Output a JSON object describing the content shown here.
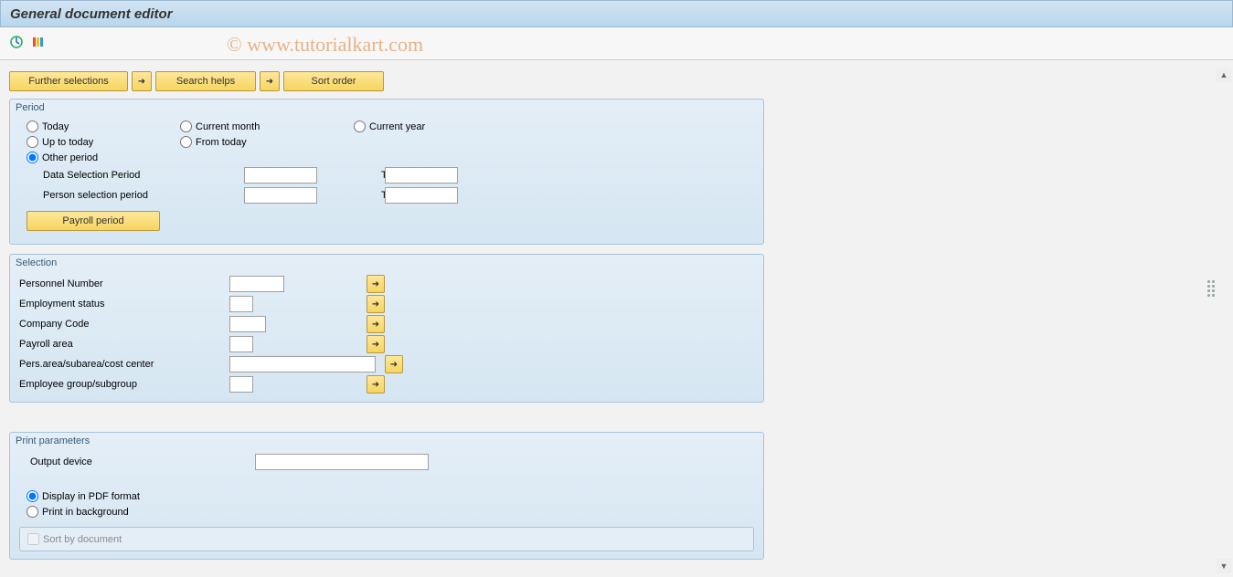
{
  "header": {
    "title": "General document editor"
  },
  "watermark": "© www.tutorialkart.com",
  "toolbar": {
    "execute_icon": "execute-icon",
    "variants_icon": "variants-icon"
  },
  "buttons": {
    "further_selections": "Further selections",
    "search_helps": "Search helps",
    "sort_order": "Sort order"
  },
  "period": {
    "group_title": "Period",
    "today": "Today",
    "current_month": "Current month",
    "current_year": "Current year",
    "up_to_today": "Up to today",
    "from_today": "From today",
    "other_period": "Other period",
    "data_selection_period": "Data Selection Period",
    "person_selection_period": "Person selection period",
    "to": "To",
    "payroll_period": "Payroll period",
    "selected_radio": "other_period"
  },
  "selection": {
    "group_title": "Selection",
    "rows": {
      "personnel_number": "Personnel Number",
      "employment_status": "Employment status",
      "company_code": "Company Code",
      "payroll_area": "Payroll area",
      "pers_area": "Pers.area/subarea/cost center",
      "employee_group": "Employee group/subgroup"
    }
  },
  "print": {
    "group_title": "Print parameters",
    "output_device": "Output device",
    "display_pdf": "Display in PDF format",
    "print_bg": "Print in background",
    "sort_by_document": "Sort by document",
    "selected_radio": "display_pdf"
  }
}
